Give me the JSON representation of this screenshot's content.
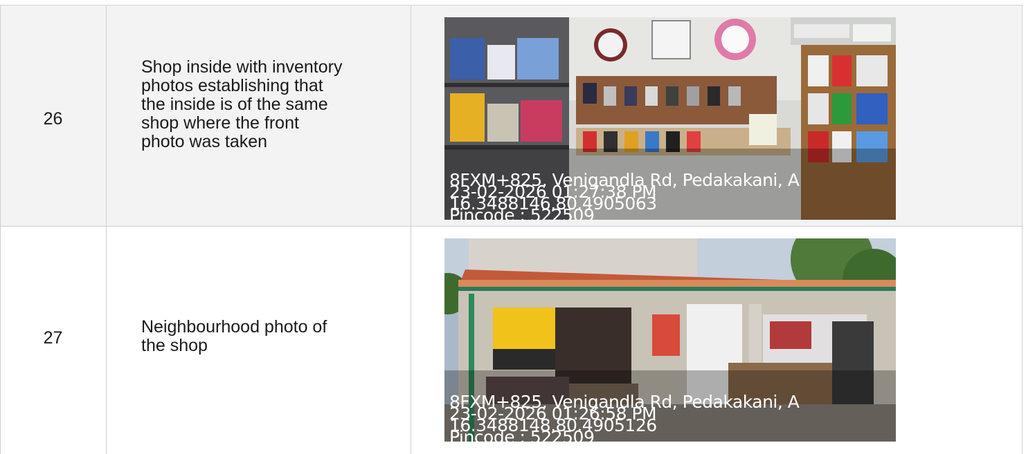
{
  "rows": [
    {
      "number": "26",
      "description_lines": [
        "Shop inside with inventory",
        "photos establishing that",
        "the inside is of the same",
        "shop where the front",
        "photo was taken"
      ],
      "photo_stamp": [
        "8FXM+825, Venigandla Rd, Pedakakani, A",
        "23-02-2026 01:27:38 PM",
        "16.3488146,80.4905063",
        "Pincode : 522509"
      ]
    },
    {
      "number": "27",
      "description_lines": [
        "Neighbourhood photo of",
        "the shop"
      ],
      "photo_stamp": [
        "8FXM+825, Venigandla Rd, Pedakakani, A",
        "23-02-2026 01:26:58 PM",
        "16.3488148,80.4905126",
        "Pincode : 522509"
      ]
    }
  ]
}
